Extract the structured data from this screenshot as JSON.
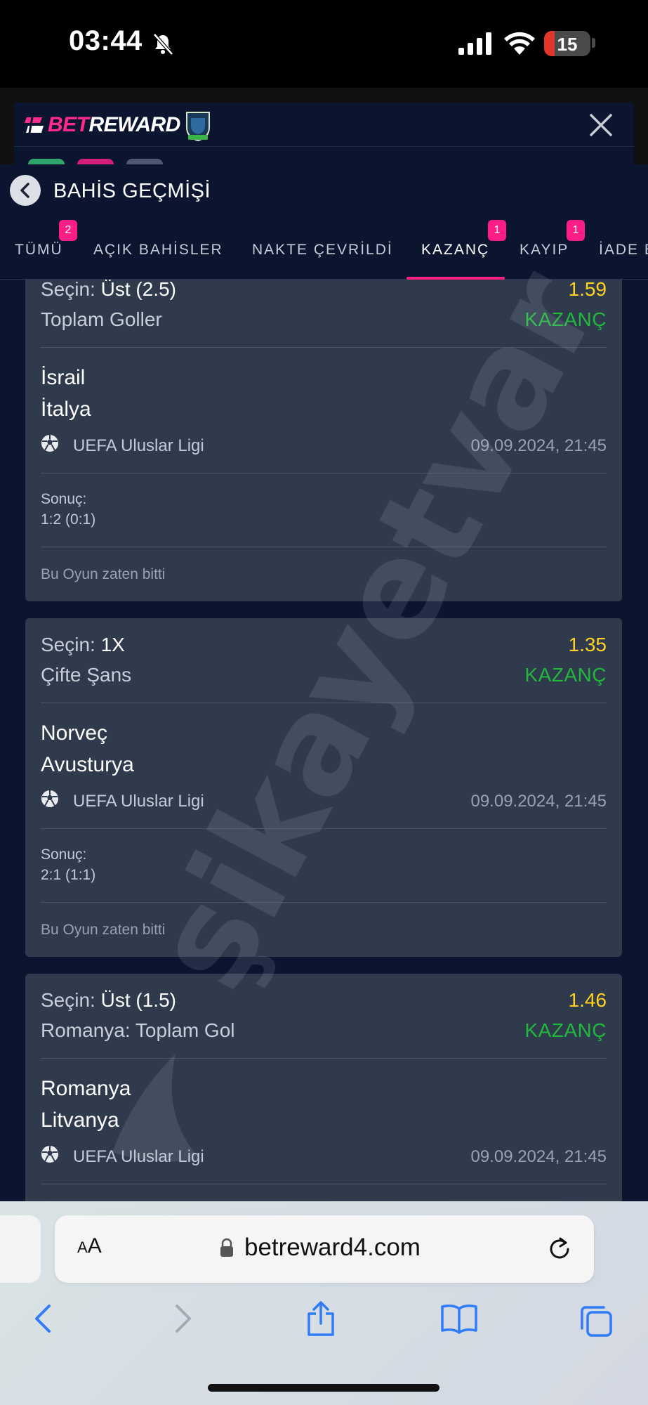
{
  "status_bar": {
    "time": "03:44",
    "battery": "15",
    "icons": [
      "bell-slash-icon",
      "cellular-signal-icon",
      "wifi-icon",
      "battery-icon"
    ]
  },
  "site": {
    "logo_bet": "BET",
    "logo_reward": "REWARD",
    "close_icon": "close-icon"
  },
  "page": {
    "title": "BAHİS GEÇMİŞİ"
  },
  "tabs": [
    {
      "label": "TÜMÜ",
      "badge": "2",
      "active": false
    },
    {
      "label": "AÇIK BAHİSLER",
      "badge": "",
      "active": false
    },
    {
      "label": "NAKTE ÇEVRİLDİ",
      "badge": "",
      "active": false
    },
    {
      "label": "KAZANÇ",
      "badge": "1",
      "active": true
    },
    {
      "label": "KAYIP",
      "badge": "1",
      "active": false
    },
    {
      "label": "İADE E",
      "badge": "",
      "active": false
    }
  ],
  "bets": [
    {
      "selection_prefix": "Seçin:",
      "selection_value": "Üst (2.5)",
      "market": "Toplam Goller",
      "odds": "1.59",
      "status": "KAZANÇ",
      "home_team": "İsrail",
      "away_team": "İtalya",
      "league": "UEFA Uluslar Ligi",
      "date": "09.09.2024, 21:45",
      "result_label": "Sonuç:",
      "result": "1:2 (0:1)",
      "game_status": "Bu Oyun zaten bitti"
    },
    {
      "selection_prefix": "Seçin:",
      "selection_value": "1X",
      "market": "Çifte Şans",
      "odds": "1.35",
      "status": "KAZANÇ",
      "home_team": "Norveç",
      "away_team": "Avusturya",
      "league": "UEFA Uluslar Ligi",
      "date": "09.09.2024, 21:45",
      "result_label": "Sonuç:",
      "result": "2:1 (1:1)",
      "game_status": "Bu Oyun zaten bitti"
    },
    {
      "selection_prefix": "Seçin:",
      "selection_value": "Üst (1.5)",
      "market": "Romanya: Toplam Gol",
      "odds": "1.46",
      "status": "KAZANÇ",
      "home_team": "Romanya",
      "away_team": "Litvanya",
      "league": "UEFA Uluslar Ligi",
      "date": "09.09.2024, 21:45"
    }
  ],
  "watermark": "şikayetvar",
  "browser": {
    "aa_label_small": "A",
    "aa_label_large": "A",
    "url": "betreward4.com",
    "toolbar_icons": [
      "back-icon",
      "forward-icon",
      "share-icon",
      "bookmarks-icon",
      "tabs-icon"
    ]
  },
  "colors": {
    "accent": "#ff1e86",
    "odds": "#ffd21f",
    "won": "#22b83e",
    "background": "#0b1530",
    "card": "#2f3a4d"
  }
}
